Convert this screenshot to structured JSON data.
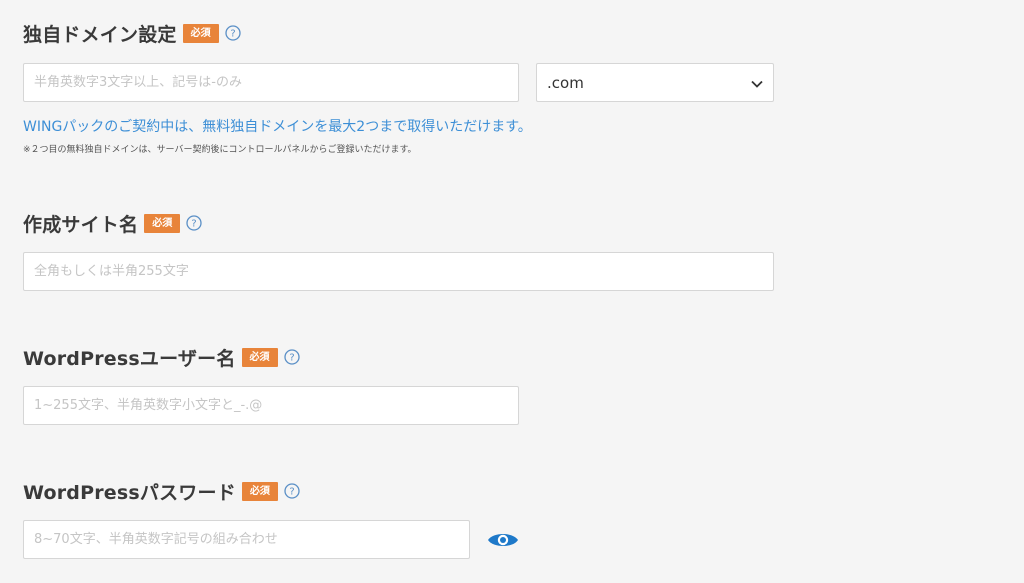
{
  "domain_setting": {
    "label": "独自ドメイン設定",
    "required_badge": "必須",
    "input_placeholder": "半角英数字3文字以上、記号は-のみ",
    "tld_selected": ".com",
    "note_blue": "WINGパックのご契約中は、無料独自ドメインを最大2つまで取得いただけます。",
    "note_small": "※２つ目の無料独自ドメインは、サーバー契約後にコントロールパネルからご登録いただけます。"
  },
  "site_name": {
    "label": "作成サイト名",
    "required_badge": "必須",
    "input_placeholder": "全角もしくは半角255文字"
  },
  "wp_user": {
    "label": "WordPressユーザー名",
    "required_badge": "必須",
    "input_placeholder": "1~255文字、半角英数字小文字と_-.@"
  },
  "wp_password": {
    "label": "WordPressパスワード",
    "required_badge": "必須",
    "input_placeholder": "8~70文字、半角英数字記号の組み合わせ"
  },
  "icons": {
    "help": "question-circle-icon",
    "dropdown": "chevron-down-icon",
    "show_password": "eye-icon"
  },
  "colors": {
    "badge": "#e8843a",
    "link_blue": "#3d8fd6",
    "help_icon": "#5a8fc6",
    "eye_icon": "#1e79c9"
  }
}
